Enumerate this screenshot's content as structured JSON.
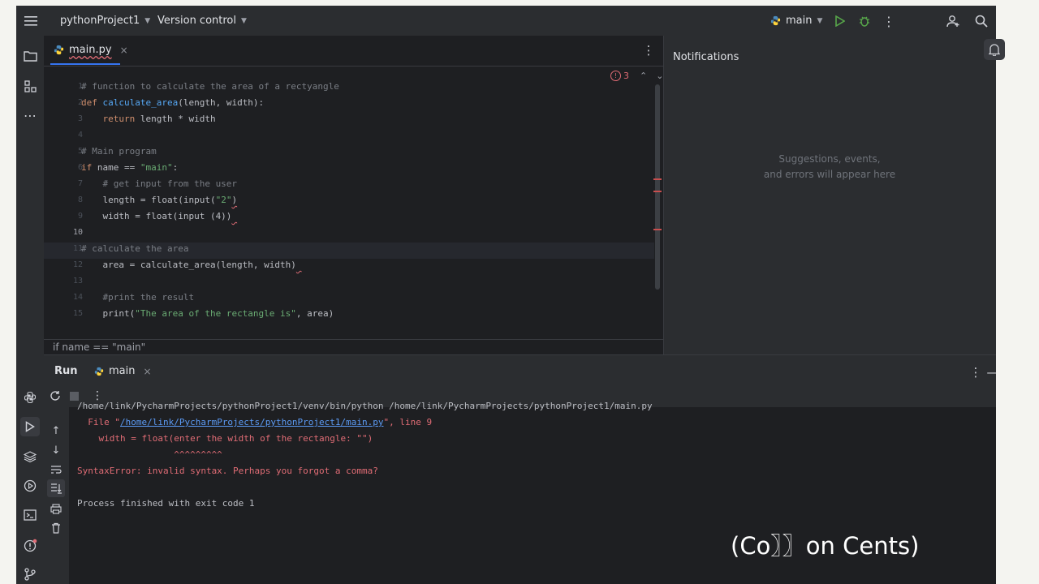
{
  "topbar": {
    "project": "pythonProject1",
    "vcs": "Version control",
    "run_config": "main"
  },
  "editor": {
    "tab_name": "main.py",
    "error_count": "3",
    "lines": [
      {
        "n": "1",
        "tokens": [
          {
            "t": "# function to calculate the area of a rectyangle",
            "c": "cm"
          }
        ]
      },
      {
        "n": "2",
        "tokens": [
          {
            "t": "def ",
            "c": "kw"
          },
          {
            "t": "calculate_area",
            "c": "fn"
          },
          {
            "t": "(length, width):",
            "c": ""
          }
        ]
      },
      {
        "n": "3",
        "tokens": [
          {
            "t": "    ",
            "c": ""
          },
          {
            "t": "return ",
            "c": "kw"
          },
          {
            "t": "length * width",
            "c": ""
          }
        ]
      },
      {
        "n": "4",
        "tokens": []
      },
      {
        "n": "5",
        "tokens": [
          {
            "t": "# Main program",
            "c": "cm"
          }
        ]
      },
      {
        "n": "6",
        "tokens": [
          {
            "t": "if ",
            "c": "kw"
          },
          {
            "t": "name == ",
            "c": ""
          },
          {
            "t": "\"main\"",
            "c": "str"
          },
          {
            "t": ":",
            "c": ""
          }
        ]
      },
      {
        "n": "7",
        "tokens": [
          {
            "t": "    # get input from the user",
            "c": "cm"
          }
        ]
      },
      {
        "n": "8",
        "tokens": [
          {
            "t": "    length = float(input(",
            "c": ""
          },
          {
            "t": "\"2\"",
            "c": "str"
          },
          {
            "t": ")",
            "c": "squig"
          }
        ]
      },
      {
        "n": "9",
        "tokens": [
          {
            "t": "    width = float(input (4))",
            "c": ""
          },
          {
            "t": " ",
            "c": "squig"
          }
        ]
      },
      {
        "n": "10",
        "tokens": []
      },
      {
        "n": "11",
        "tokens": [
          {
            "t": "# calculate the area",
            "c": "cm"
          }
        ]
      },
      {
        "n": "12",
        "tokens": [
          {
            "t": "    area = calculate_area(length, width)",
            "c": ""
          },
          {
            "t": " ",
            "c": "squig"
          }
        ]
      },
      {
        "n": "13",
        "tokens": []
      },
      {
        "n": "14",
        "tokens": [
          {
            "t": "    #print the result",
            "c": "cm"
          }
        ]
      },
      {
        "n": "15",
        "tokens": [
          {
            "t": "    print(",
            "c": ""
          },
          {
            "t": "\"The area of the rectangle is\"",
            "c": "str"
          },
          {
            "t": ", area)",
            "c": ""
          }
        ]
      }
    ],
    "breadcrumb": "if name == \"main\""
  },
  "notifications": {
    "title": "Notifications",
    "empty_line1": "Suggestions, events,",
    "empty_line2": "and errors will appear here"
  },
  "run": {
    "label": "Run",
    "config": "main",
    "console": {
      "line1": "/home/link/PycharmProjects/pythonProject1/venv/bin/python /home/link/PycharmProjects/pythonProject1/main.py",
      "line2_prefix": "  File \"",
      "line2_link": "/home/link/PycharmProjects/pythonProject1/main.py",
      "line2_suffix": "\", line 9",
      "line3": "    width = float(enter the width of the rectangle: \"\")",
      "line4": "                  ^^^^^^^^^",
      "line5": "SyntaxError: invalid syntax. Perhaps you forgot a comma?",
      "line6": "",
      "line7": "Process finished with exit code 1"
    }
  },
  "watermark": "(Co〗〗on Cents)"
}
